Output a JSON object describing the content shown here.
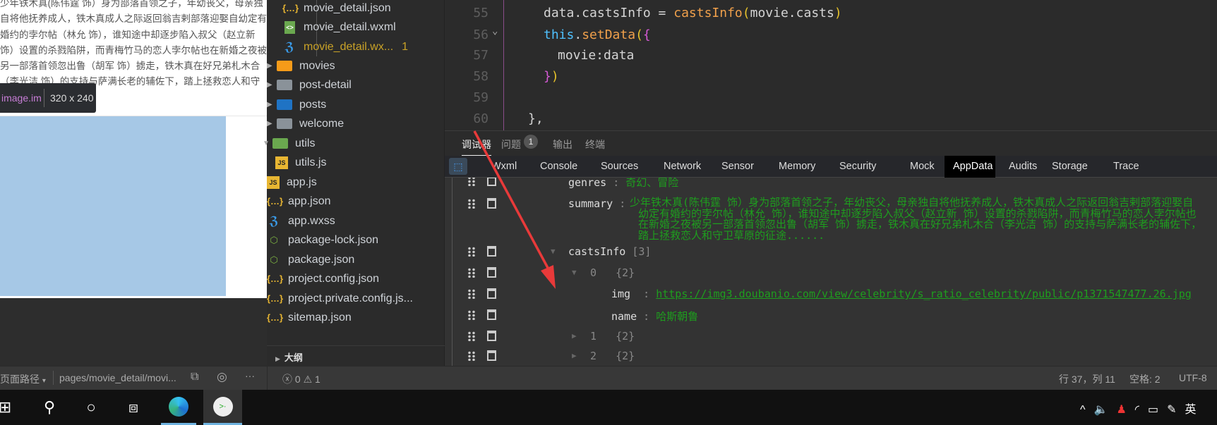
{
  "simulator": {
    "summary": "少年铁木真(陈伟霆 饰）身为部落首领之子，年幼丧父，母亲独自将他抚养成人，铁木真成人之际返回翁吉剌部落迎娶自幼定有婚约的孛尔帖（林允 饰），谁知途中却逐步陷入叔父（赵立新 饰）设置的杀戮陷阱，而青梅竹马的恋人孛尔帖也在新婚之夜被另一部落首领忽出鲁（胡军 饰）掳走，铁木真在好兄弟札木合（李光洁 饰）的支持与萨满长老的辅佐下，踏上拯救恋人和守卫草原的征途......",
    "tooltip_tag": "image.im",
    "tooltip_size": "320 x 240",
    "image_color": "#a6c8e6"
  },
  "file_tree": {
    "items": [
      {
        "label": "movie_detail.json",
        "icon": "json-icon"
      },
      {
        "label": "movie_detail.wxml",
        "icon": "wxml-icon"
      },
      {
        "label": "movie_detail.wx...",
        "icon": "css-icon",
        "badge": "1"
      },
      {
        "label": "movies",
        "icon": "folder-orange-icon"
      },
      {
        "label": "post-detail",
        "icon": "folder-icon"
      },
      {
        "label": "posts",
        "icon": "folder-blue-icon"
      },
      {
        "label": "welcome",
        "icon": "folder-icon"
      },
      {
        "label": "utils",
        "icon": "folder-green-icon"
      },
      {
        "label": "utils.js",
        "icon": "js-icon"
      },
      {
        "label": "app.js",
        "icon": "js-icon"
      },
      {
        "label": "app.json",
        "icon": "json-icon"
      },
      {
        "label": "app.wxss",
        "icon": "css-icon"
      },
      {
        "label": "package-lock.json",
        "icon": "node-icon"
      },
      {
        "label": "package.json",
        "icon": "node-icon"
      },
      {
        "label": "project.config.json",
        "icon": "json-icon"
      },
      {
        "label": "project.private.config.js...",
        "icon": "json-icon"
      },
      {
        "label": "sitemap.json",
        "icon": "json-icon"
      }
    ],
    "outline_label": "大纲"
  },
  "code": {
    "line_numbers": [
      "55",
      "56",
      "57",
      "58",
      "59",
      "60"
    ],
    "l55a": "data.castsInfo = ",
    "l55b": "castsInfo",
    "l55c": "(",
    "l55d": "movie.casts",
    "l55e": ")",
    "l56a": "this",
    "l56b": ".",
    "l56c": "setData",
    "l56d": "(",
    "l56e": "{",
    "l57": "movie:data",
    "l58a": "}",
    "l58b": ")",
    "l60": "},"
  },
  "panel_tabs": {
    "debugger": "调试器",
    "problems": "问题",
    "problems_count": "1",
    "output": "输出",
    "terminal": "终端"
  },
  "devtools_tabs": [
    "Wxml",
    "Console",
    "Sources",
    "Network",
    "Sensor",
    "Memory",
    "Security",
    "Mock",
    "AppData",
    "Audits",
    "Storage",
    "Trace"
  ],
  "appdata": {
    "genres_key": "genres",
    "genres_val": "奇幻、冒险",
    "summary_key": "summary",
    "summary_lines": [
      "少年铁木真(陈伟霆 饰）身为部落首领之子，年幼丧父，母亲独自将他抚养成人，铁木真成人之际返回翁吉剌部落迎娶自",
      "幼定有婚约的孛尔帖（林允 饰），谁知途中却逐步陷入叔父（赵立新 饰）设置的杀戮陷阱，而青梅竹马的恋人孛尔帖也",
      "在新婚之夜被另一部落首领忽出鲁（胡军 饰）掳走，铁木真在好兄弟札木合（李光洁 饰）的支持与萨满长老的辅佐下，",
      "踏上拯救恋人和守卫草原的征途......"
    ],
    "casts_key": "castsInfo",
    "casts_count": "[3]",
    "item0_index": "0",
    "item0_count": "{2}",
    "img_key": "img",
    "img_val": "https://img3.doubanio.com/view/celebrity/s_ratio_celebrity/public/p1371547477.26.jpg",
    "name_key": "name",
    "name_val": "哈斯朝鲁",
    "item1_index": "1",
    "item1_count": "{2}",
    "item2_index": "2",
    "item2_count": "{2}"
  },
  "status": {
    "page_path_label": "页面路径",
    "page_path": "pages/movie_detail/movi...",
    "errors": "0",
    "warnings": "1",
    "cursor": "行 37，列 11",
    "indent": "空格: 2",
    "encoding": "UTF-8"
  },
  "taskbar": {
    "ime": "英"
  },
  "colors": {
    "accent_green": "#1e9e1e",
    "annotation_red": "#e83a3a"
  }
}
